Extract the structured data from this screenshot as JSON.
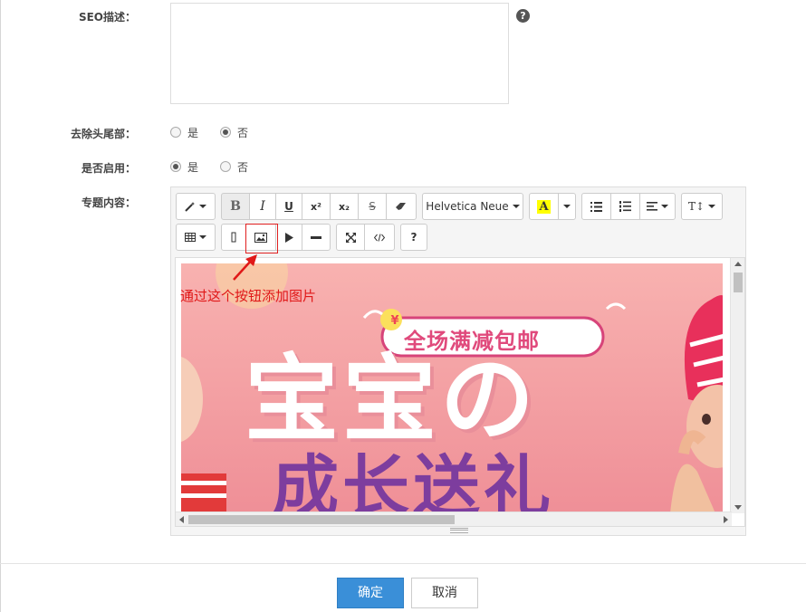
{
  "form": {
    "seo_label": "SEO描述：",
    "header_footer_label": "去除头尾部：",
    "enabled_label": "是否启用：",
    "content_label": "专题内容：",
    "yes": "是",
    "no": "否",
    "header_footer_selected": "否",
    "enabled_selected": "是",
    "help_glyph": "?"
  },
  "editor": {
    "font_name": "Helvetica Neue",
    "bold": "B",
    "italic": "I",
    "underline": "U",
    "superscript": "x²",
    "subscript": "x₂",
    "strike": "S",
    "text_size": "T↕",
    "help": "?"
  },
  "banner": {
    "badge": "全场满减包邮",
    "headline": "宝宝の",
    "subline": "成长送礼"
  },
  "annotation": {
    "text": "通过这个按钮添加图片",
    "color": "#e01818"
  },
  "footer": {
    "confirm": "确定",
    "cancel": "取消"
  },
  "colors": {
    "primary": "#3a8fd8",
    "banner_bg": "#f4a1a4"
  }
}
